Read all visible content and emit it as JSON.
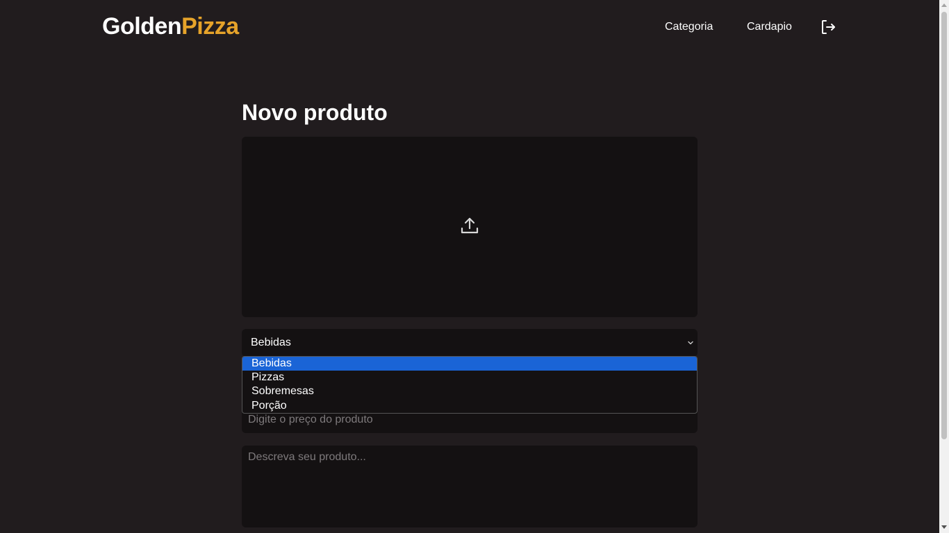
{
  "brand": {
    "part1": "Golden",
    "part2": "Pizza",
    "accent_color": "#e6a32a"
  },
  "nav": {
    "categoria": "Categoria",
    "cardapio": "Cardapio",
    "logout_icon": "logout-icon"
  },
  "main": {
    "title": "Novo produto",
    "upload_icon": "upload-icon",
    "category_select": {
      "value": "Bebidas",
      "options": [
        "Bebidas",
        "Pizzas",
        "Sobremesas",
        "Porção"
      ],
      "selected_index": 0
    },
    "price_placeholder": "Digite o preço do produto",
    "description_placeholder": "Descreva seu produto..."
  },
  "colors": {
    "background": "#211c1e",
    "input_background": "#141112",
    "selected_option": "#1a64d6"
  }
}
